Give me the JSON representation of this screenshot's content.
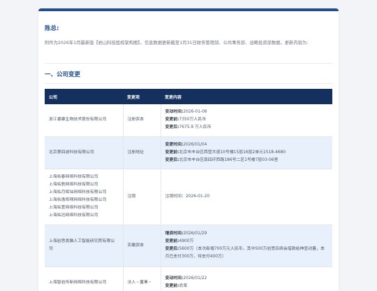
{
  "greeting": "陈总:",
  "intro": "附件为2026年1月最新版【岩山科技股权架构图】，信息数据更新截至1月31日财务管理部、公共事务部、战略投资部数据。更新内容为:",
  "section_title": "一、公司变更",
  "table": {
    "headers": [
      "公司",
      "变更项",
      "变更内容"
    ],
    "rows": [
      {
        "companies": [
          "浙江睿康生物技术股份有限公司"
        ],
        "item": "注册资本",
        "details": [
          {
            "label": "变动时间:",
            "value": "2026-01-06"
          },
          {
            "label": "变更前:",
            "value": "7350万人民币"
          },
          {
            "label": "变更后:",
            "value": "7675.9 万人民币"
          }
        ]
      },
      {
        "companies": [
          "北京第四波科技有限公司"
        ],
        "item": "注册地址",
        "details": [
          {
            "label": "变更时间:",
            "value": "2026/01/04"
          },
          {
            "label": "变更前:",
            "value": "北京市丰台区西营大道10号楼15层16层2单元1518-4680"
          },
          {
            "label": "变更后:",
            "value": "北京市丰台区南四环西路186号二区1号楼7层03-06室"
          }
        ]
      },
      {
        "companies": [
          "上海佑春网络科技有限公司",
          "上海佑驰网络科技有限公司",
          "上海佑月辉灿网络科技有限公司",
          "上海佑逸晖翔网络科技有限公司",
          "上海佑萱网络科技有限公司",
          "上海佑迅网络科技有限公司"
        ],
        "item": "注销",
        "details": [
          {
            "label": "",
            "value": "注销时间：2026-01-20"
          }
        ]
      },
      {
        "companies": [
          "上海岩思类脑人工智能研究院有限公司"
        ],
        "item": "实缴资本",
        "details": [
          {
            "label": "增资时间:",
            "value": "2026/01/29"
          },
          {
            "label": "变更前:",
            "value": "4900万"
          },
          {
            "label": "变更后:",
            "value": "5600万（本次新增700万元人民币，其中500万岩思后续会借款给神显动量，本月已支付300万，待支付400万）"
          }
        ]
      },
      {
        "companies": [
          "上海智岩传新网络科技有限公司"
        ],
        "item": "法人・董事・",
        "details": [
          {
            "label": "变动时间:",
            "value": "2026/01/22"
          },
          {
            "label": "变更前:",
            "value": "俞某"
          }
        ]
      }
    ]
  }
}
